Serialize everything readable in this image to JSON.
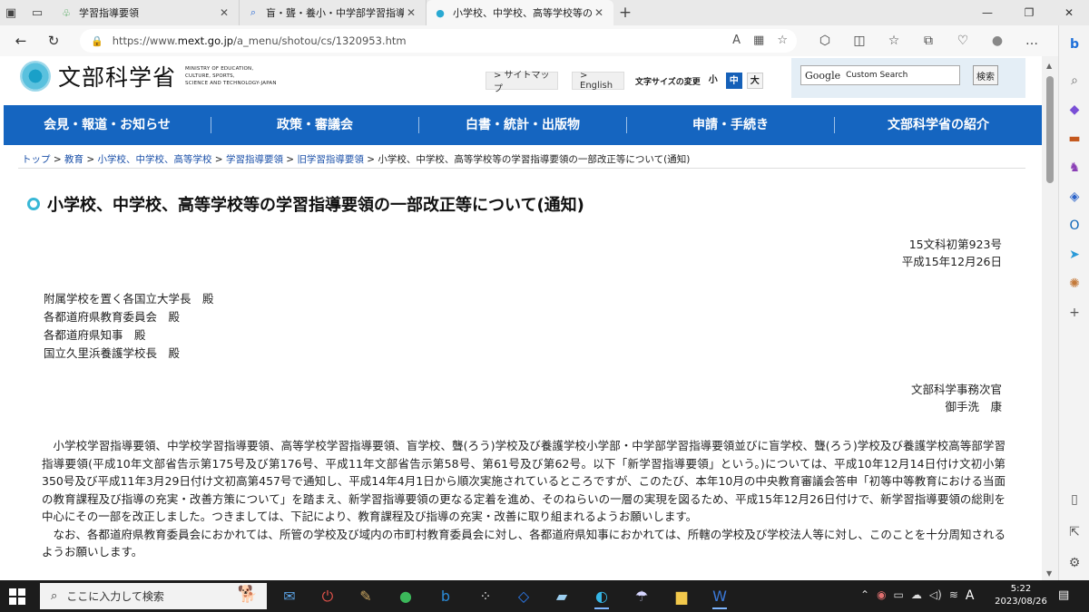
{
  "browser": {
    "tabs": [
      {
        "title": "学習指導要領",
        "icon": "green-leaf-icon"
      },
      {
        "title": "盲・聾・養小・中学部学習指導要領",
        "icon": "search-icon"
      },
      {
        "title": "小学校、中学校、高等学校等の学習",
        "icon": "mext-icon"
      }
    ],
    "url_prefix": "https://www.",
    "url_host": "mext.go.jp",
    "url_path": "/a_menu/shotou/cs/1320953.htm"
  },
  "site": {
    "logo_jp": "文部科学省",
    "logo_en": [
      "MINISTRY OF EDUCATION,",
      "CULTURE, SPORTS,",
      "SCIENCE AND TECHNOLOGY-JAPAN"
    ],
    "sitemap": "> サイトマップ",
    "english": "> English",
    "fontsize_label": "文字サイズの変更",
    "fontsize_small": "小",
    "fontsize_medium": "中",
    "fontsize_large": "大",
    "search_brand": "Google",
    "search_placeholder": "Custom Search",
    "search_button": "検索"
  },
  "nav": [
    "会見・報道・お知らせ",
    "政策・審議会",
    "白書・統計・出版物",
    "申請・手続き",
    "文部科学省の紹介"
  ],
  "breadcrumb": [
    "トップ",
    "教育",
    "小学校、中学校、高等学校",
    "学習指導要領",
    "旧学習指導要領"
  ],
  "breadcrumb_current": "小学校、中学校、高等学校等の学習指導要領の一部改正等について(通知)",
  "doc": {
    "title": "小学校、中学校、高等学校等の学習指導要領の一部改正等について(通知)",
    "number": "15文科初第923号",
    "date": "平成15年12月26日",
    "recipients": [
      "附属学校を置く各国立大学長　殿",
      "各都道府県教育委員会　殿",
      "各都道府県知事　殿",
      "国立久里浜養護学校長　殿"
    ],
    "sender_org": "文部科学事務次官",
    "sender_name": "御手洗　康",
    "para1": "小学校学習指導要領、中学校学習指導要領、高等学校学習指導要領、盲学校、聾(ろう)学校及び養護学校小学部・中学部学習指導要領並びに盲学校、聾(ろう)学校及び養護学校高等部学習指導要領(平成10年文部省告示第175号及び第176号、平成11年文部省告示第58号、第61号及び第62号。以下「新学習指導要領」という。)については、平成10年12月14日付け文初小第350号及び平成11年3月29日付け文初高第457号で通知し、平成14年4月1日から順次実施されているところですが、このたび、本年10月の中央教育審議会答申「初等中等教育における当面の教育課程及び指導の充実・改善方策について」を踏まえ、新学習指導要領の更なる定着を進め、そのねらいの一層の実現を図るため、平成15年12月26日付けで、新学習指導要領の総則を中心にその一部を改正しました。つきましては、下記により、教育課程及び指導の充実・改善に取り組まれるようお願いします。",
    "para2": "なお、各都道府県教育委員会におかれては、所管の学校及び域内の市町村教育委員会に対し、各都道府県知事におかれては、所轄の学校及び学校法人等に対し、このことを十分周知されるようお願いします。"
  },
  "taskbar": {
    "search_placeholder": "ここに入力して検索",
    "time": "5:22",
    "date": "2023/08/26",
    "ime": "A"
  },
  "colors": {
    "nav_bg": "#1565c0",
    "link": "#1a4fa8",
    "title_dot": "#38b7d6"
  }
}
